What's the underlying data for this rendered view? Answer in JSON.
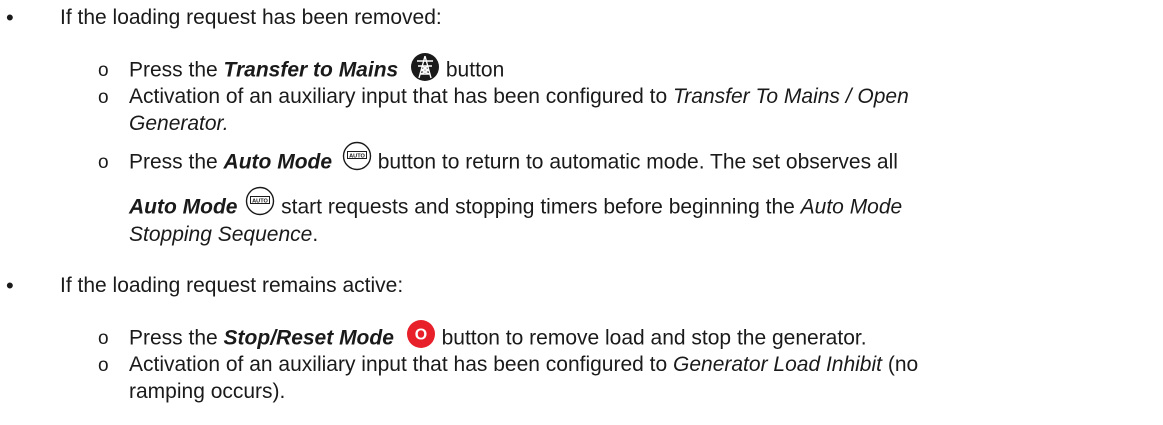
{
  "section1": {
    "bullet": "•",
    "heading": "If the loading request has been removed:",
    "items": [
      {
        "marker": "o",
        "pre": "Press the ",
        "bold": "Transfer to Mains",
        "post": " button",
        "icon": "transmission-tower-icon"
      },
      {
        "marker": "o",
        "line1_pre": "Activation of an auxiliary input that has been configured to ",
        "line1_italic": "Transfer To Mains / Open",
        "line2_italic": "Generator."
      },
      {
        "marker": "o",
        "line1_pre": "Press the ",
        "line1_bold": "Auto Mode",
        "line1_post": " button to return to automatic mode. The set observes all",
        "line2_bold": "Auto Mode",
        "line2_post": " start requests and stopping timers before beginning the ",
        "line2_italic": "Auto Mode",
        "line3_italic": "Stopping Sequence",
        "line3_post": ".",
        "icon_text": "AUTO"
      }
    ]
  },
  "section2": {
    "bullet": "•",
    "heading": "If the loading request remains active:",
    "items": [
      {
        "marker": "o",
        "pre": "Press the ",
        "bold": "Stop/Reset Mode",
        "post": " button to remove load and stop the generator.",
        "icon_text": "O"
      },
      {
        "marker": "o",
        "line1_pre": "Activation of an auxiliary input that has been configured to ",
        "line1_italic": "Generator Load Inhibit",
        "line1_post": " (no",
        "line2": "ramping occurs)."
      }
    ]
  },
  "colors": {
    "text": "#1a1a1a",
    "stop_red": "#e8202a"
  }
}
